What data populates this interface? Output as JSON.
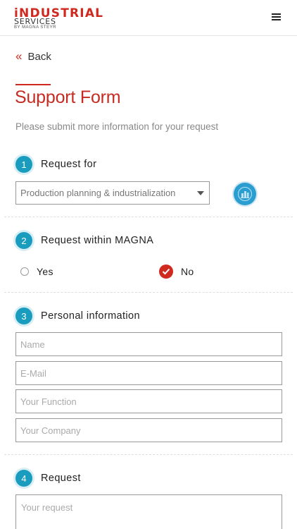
{
  "header": {
    "logo_main": "iNDUSTRIAL",
    "logo_sub": "SERVICES",
    "logo_tag": "BY MAGNA STEYR"
  },
  "back_label": "Back",
  "page_title": "Support Form",
  "page_subtitle": "Please submit more information for your request",
  "steps": [
    {
      "number": "1",
      "label": "Request for"
    },
    {
      "number": "2",
      "label": "Request within MAGNA"
    },
    {
      "number": "3",
      "label": "Personal information"
    },
    {
      "number": "4",
      "label": "Request"
    }
  ],
  "request_for": {
    "selected": "Production planning & industrialization"
  },
  "within_magna": {
    "yes_label": "Yes",
    "no_label": "No",
    "selected": "No"
  },
  "personal": {
    "name_placeholder": "Name",
    "email_placeholder": "E-Mail",
    "function_placeholder": "Your Function",
    "company_placeholder": "Your Company"
  },
  "request": {
    "placeholder": "Your request"
  },
  "colors": {
    "brand_red": "#d0291f",
    "step_blue": "#1a9cbf"
  }
}
